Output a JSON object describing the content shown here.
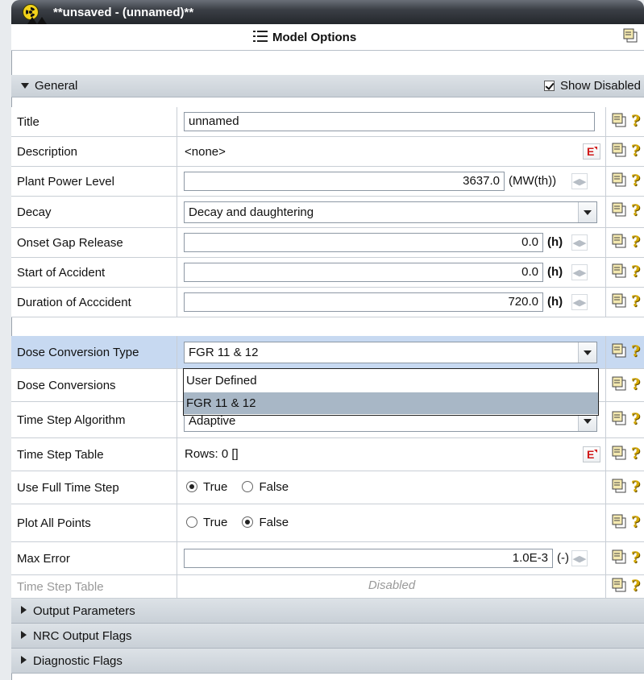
{
  "window": {
    "title": "**unsaved - (unnamed)**"
  },
  "panel": {
    "title": "Model Options"
  },
  "general": {
    "label": "General",
    "show_disabled_label": "Show Disabled",
    "show_disabled_checked": true
  },
  "rows": {
    "title": {
      "label": "Title",
      "value": "unnamed"
    },
    "description": {
      "label": "Description",
      "value": "<none>",
      "edit_label": "E"
    },
    "plant_power": {
      "label": "Plant Power Level",
      "value": "3637.0",
      "unit": "(MW(th))"
    },
    "decay": {
      "label": "Decay",
      "value": "Decay and daughtering"
    },
    "onset_gap": {
      "label": "Onset Gap Release",
      "value": "0.0",
      "unit": "(h)"
    },
    "start_accident": {
      "label": "Start of Accident",
      "value": "0.0",
      "unit": "(h)"
    },
    "duration_accident": {
      "label": "Duration of Acccident",
      "value": "720.0",
      "unit": "(h)"
    },
    "dose_conversion_type": {
      "label": "Dose Conversion Type",
      "value": "FGR 11 & 12",
      "options": [
        "User Defined",
        "FGR 11 & 12"
      ]
    },
    "dose_conversions": {
      "label": "Dose Conversions"
    },
    "time_step_algorithm": {
      "label": "Time Step Algorithm",
      "value": "Adaptive"
    },
    "time_step_table": {
      "label": "Time Step Table",
      "value": "Rows: 0 []",
      "edit_label": "E"
    },
    "use_full_time_step": {
      "label": "Use Full Time Step",
      "true_label": "True",
      "false_label": "False",
      "selected": "True"
    },
    "plot_all_points": {
      "label": "Plot All Points",
      "true_label": "True",
      "false_label": "False",
      "selected": "False"
    },
    "max_error": {
      "label": "Max Error",
      "value": "1.0E-3",
      "unit": "(-)"
    },
    "time_step_table_disabled": {
      "label": "Time Step Table",
      "value": "Disabled"
    }
  },
  "sections": {
    "output_parameters": "Output Parameters",
    "nrc_output_flags": "NRC Output Flags",
    "diagnostic_flags": "Diagnostic Flags"
  },
  "icons": {
    "help": "?",
    "spin": "◀▶"
  }
}
